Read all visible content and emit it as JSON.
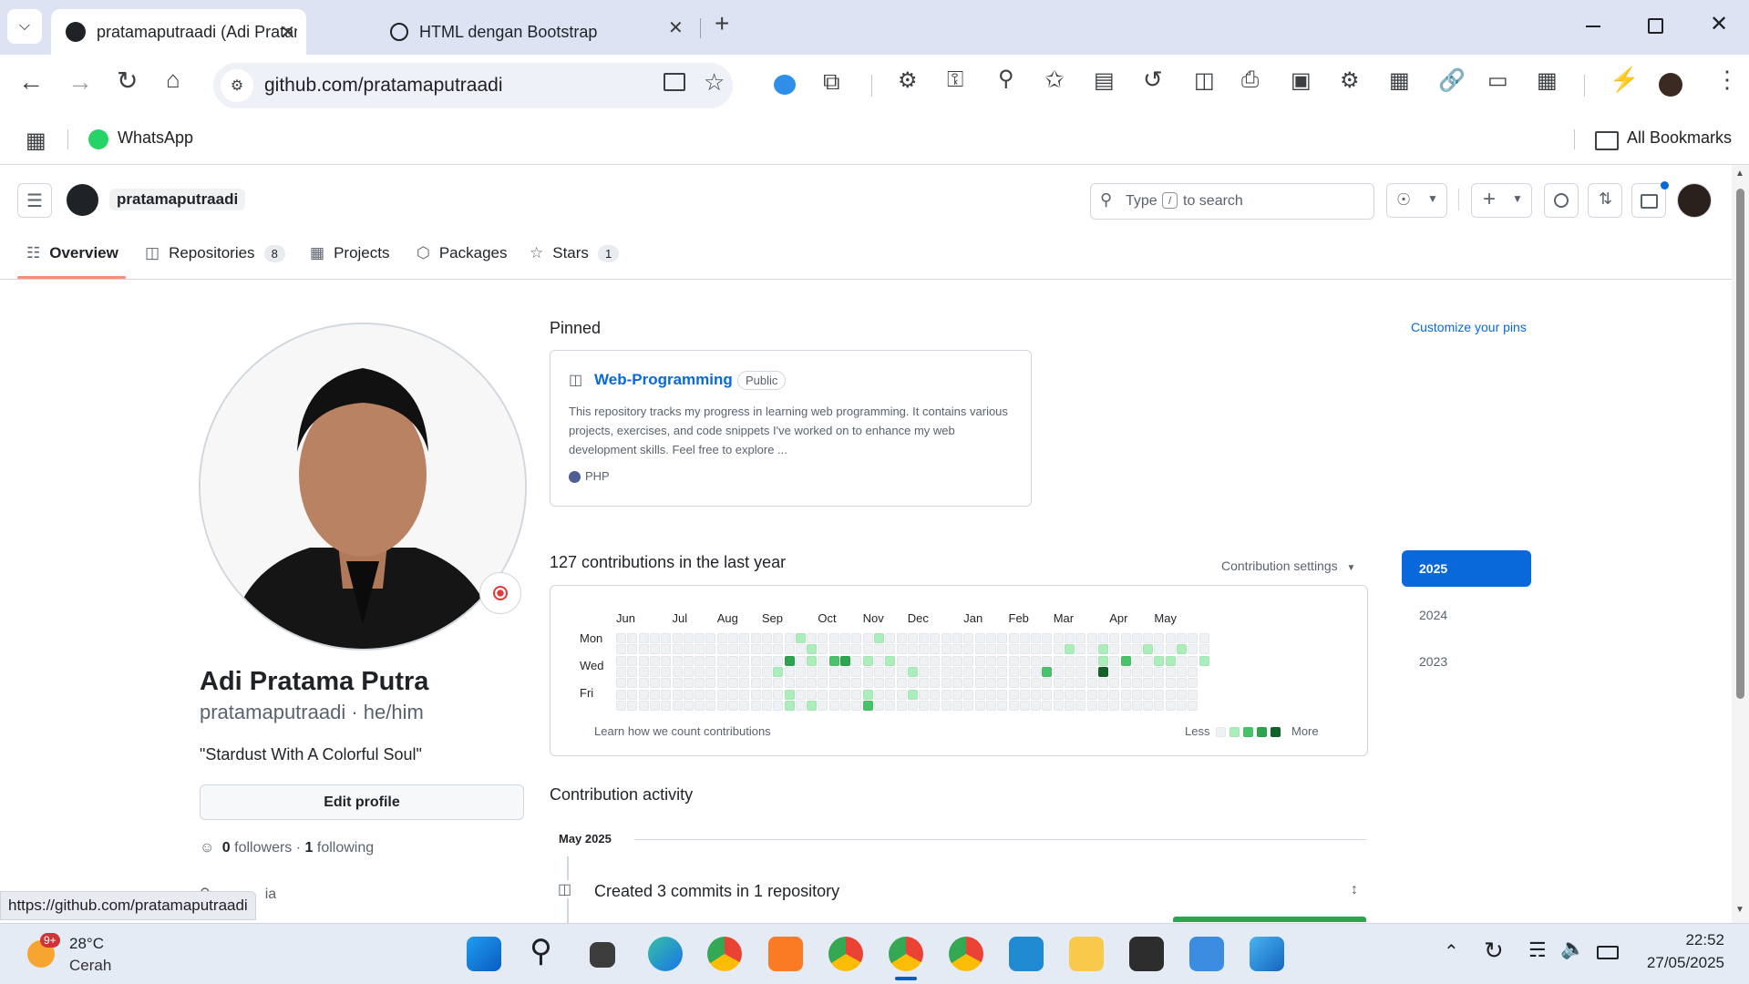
{
  "browser": {
    "tabs": [
      {
        "title": "pratamaputraadi (Adi Pratama P",
        "active": true
      },
      {
        "title": "HTML dengan Bootstrap",
        "active": false
      }
    ],
    "url": "github.com/pratamaputraadi",
    "bookmarks": [
      {
        "label": "WhatsApp"
      }
    ],
    "all_bookmarks_label": "All Bookmarks",
    "status_url": "https://github.com/pratamaputraadi"
  },
  "github": {
    "username": "pratamaputraadi",
    "search_prefix": "Type",
    "search_key": "/",
    "search_suffix": "to search",
    "nav_tabs": [
      {
        "label": "Overview",
        "icon": "book-icon"
      },
      {
        "label": "Repositories",
        "count": "8",
        "icon": "repo-icon"
      },
      {
        "label": "Projects",
        "icon": "table-icon"
      },
      {
        "label": "Packages",
        "icon": "package-icon"
      },
      {
        "label": "Stars",
        "count": "1",
        "icon": "star-icon"
      }
    ]
  },
  "profile": {
    "name": "Adi Pratama Putra",
    "username": "pratamaputraadi",
    "pronouns": "he/him",
    "bio": "\"Stardust With A Colorful Soul\"",
    "edit_label": "Edit profile",
    "followers": "0",
    "followers_label": "followers",
    "following": "1",
    "following_label": "following",
    "location_partial": "ia"
  },
  "pinned": {
    "title": "Pinned",
    "customize_label": "Customize your pins",
    "repo": {
      "name": "Web-Programming",
      "visibility": "Public",
      "description": "This repository tracks my progress in learning web programming. It contains various projects, exercises, and code snippets I've worked on to enhance my web development skills. Feel free to explore ...",
      "language": "PHP",
      "language_color": "#4F5D95"
    }
  },
  "contributions": {
    "summary": "127 contributions in the last year",
    "settings_label": "Contribution settings",
    "months": [
      "Jun",
      "Jul",
      "Aug",
      "Sep",
      "Oct",
      "Nov",
      "Dec",
      "Jan",
      "Feb",
      "Mar",
      "Apr",
      "May"
    ],
    "day_labels": [
      "Mon",
      "Wed",
      "Fri"
    ],
    "learn_label": "Learn how we count contributions",
    "less_label": "Less",
    "more_label": "More",
    "levels_palette": [
      "#eff2f5",
      "#aceebb",
      "#4ac26b",
      "#2da44e",
      "#116329"
    ],
    "active_cells": [
      {
        "w": 16,
        "d": 0,
        "l": 1
      },
      {
        "w": 23,
        "d": 0,
        "l": 1
      },
      {
        "w": 17,
        "d": 1,
        "l": 1
      },
      {
        "w": 40,
        "d": 1,
        "l": 1
      },
      {
        "w": 43,
        "d": 1,
        "l": 1
      },
      {
        "w": 47,
        "d": 1,
        "l": 1
      },
      {
        "w": 50,
        "d": 1,
        "l": 1
      },
      {
        "w": 15,
        "d": 2,
        "l": 3
      },
      {
        "w": 17,
        "d": 2,
        "l": 1
      },
      {
        "w": 19,
        "d": 2,
        "l": 2
      },
      {
        "w": 20,
        "d": 2,
        "l": 3
      },
      {
        "w": 22,
        "d": 2,
        "l": 1
      },
      {
        "w": 24,
        "d": 2,
        "l": 1
      },
      {
        "w": 43,
        "d": 2,
        "l": 1
      },
      {
        "w": 45,
        "d": 2,
        "l": 2
      },
      {
        "w": 48,
        "d": 2,
        "l": 1
      },
      {
        "w": 49,
        "d": 2,
        "l": 1
      },
      {
        "w": 52,
        "d": 2,
        "l": 1
      },
      {
        "w": 14,
        "d": 3,
        "l": 1
      },
      {
        "w": 26,
        "d": 3,
        "l": 1
      },
      {
        "w": 38,
        "d": 3,
        "l": 2
      },
      {
        "w": 43,
        "d": 3,
        "l": 4
      },
      {
        "w": 15,
        "d": 5,
        "l": 1
      },
      {
        "w": 22,
        "d": 5,
        "l": 1
      },
      {
        "w": 26,
        "d": 5,
        "l": 1
      },
      {
        "w": 15,
        "d": 6,
        "l": 1
      },
      {
        "w": 17,
        "d": 6,
        "l": 1
      },
      {
        "w": 22,
        "d": 6,
        "l": 2
      }
    ],
    "years": [
      {
        "label": "2025",
        "selected": true
      },
      {
        "label": "2024",
        "selected": false
      },
      {
        "label": "2023",
        "selected": false
      }
    ]
  },
  "activity": {
    "title": "Contribution activity",
    "month_label": "May 2025",
    "item_text": "Created 3 commits in 1 repository"
  },
  "taskbar": {
    "weather_badge": "9+",
    "temperature": "28°C",
    "condition": "Cerah",
    "time": "22:52",
    "date": "27/05/2025"
  }
}
